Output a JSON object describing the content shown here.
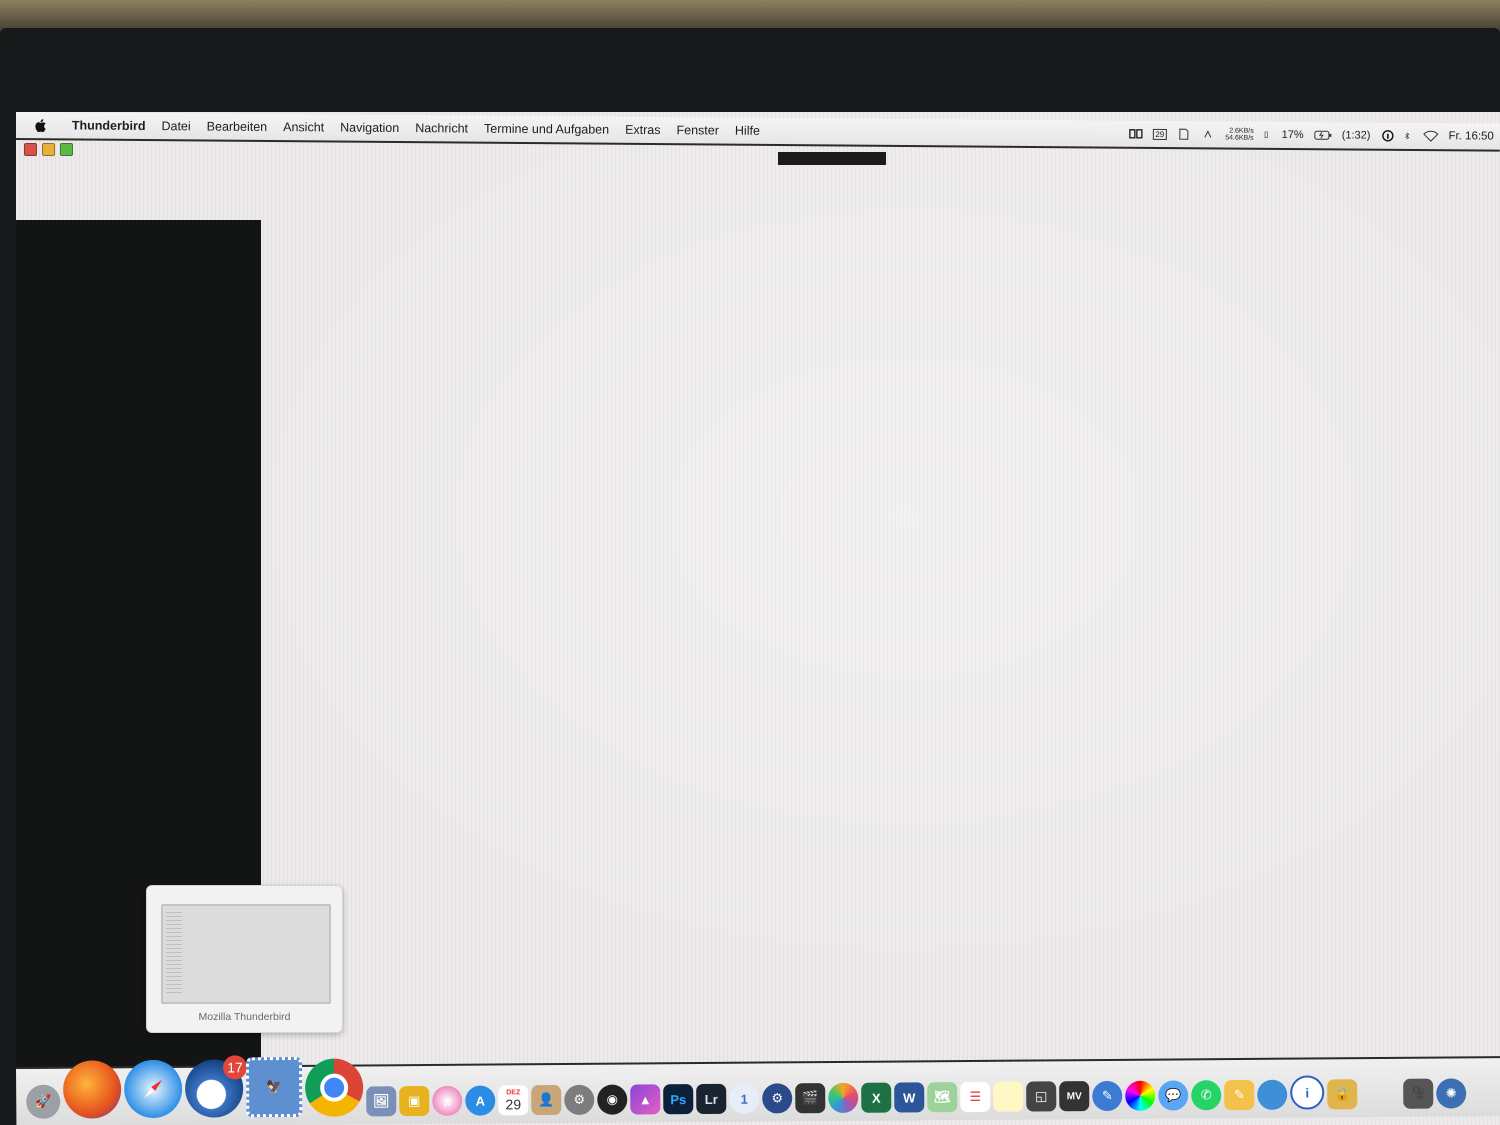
{
  "menubar": {
    "app_name": "Thunderbird",
    "items": [
      "Datei",
      "Bearbeiten",
      "Ansicht",
      "Navigation",
      "Nachricht",
      "Termine und Aufgaben",
      "Extras",
      "Fenster",
      "Hilfe"
    ],
    "status": {
      "calendar_day": "29",
      "net_up": "2.6KB/s",
      "net_down": "54.6KB/s",
      "cpu": "17%",
      "battery_time": "(1:32)",
      "clock": "Fr. 16:50"
    }
  },
  "dock": {
    "preview_label": "Mozilla Thunderbird",
    "thunderbird_badge": "17",
    "calendar_day": "29",
    "calendar_month": "DEZ",
    "app_labels": {
      "photoshop": "Ps",
      "lightroom": "Lr",
      "excel": "X",
      "word": "W",
      "moneymoney": "MV"
    }
  },
  "colors": {
    "close": "#d9534a",
    "minimize": "#e4b13a",
    "zoom": "#5cb948",
    "badge": "#e2463b"
  }
}
